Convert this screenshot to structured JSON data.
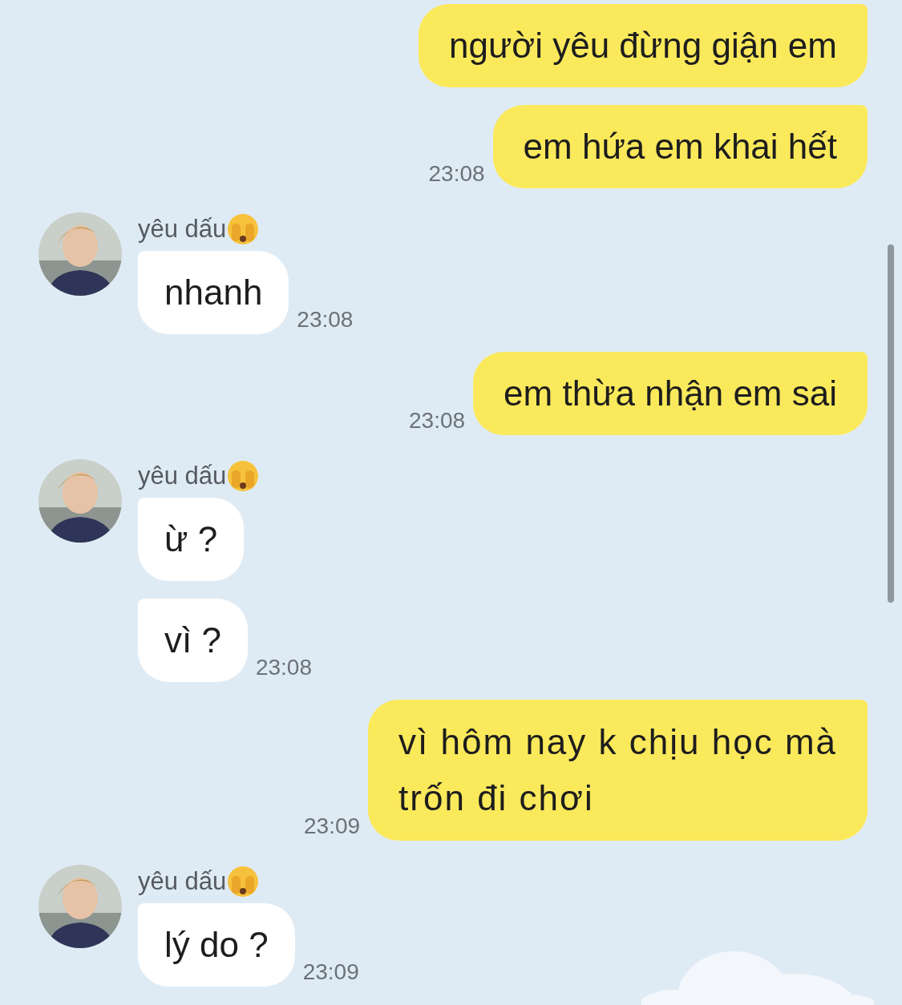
{
  "messages": [
    {
      "kind": "sent",
      "lines": [
        "người yêu đừng giận em"
      ]
    },
    {
      "kind": "sent",
      "lines": [
        "em hứa em khai hết"
      ],
      "time": "23:08"
    },
    {
      "kind": "received",
      "sender": "yêu dấu",
      "bubbles": [
        {
          "text": "nhanh"
        }
      ],
      "time": "23:08"
    },
    {
      "kind": "sent",
      "lines": [
        "em thừa nhận em sai"
      ],
      "time": "23:08"
    },
    {
      "kind": "received",
      "sender": "yêu dấu",
      "bubbles": [
        {
          "text": "ừ ?"
        },
        {
          "text": "vì ?"
        }
      ],
      "time": "23:08"
    },
    {
      "kind": "sent",
      "lines": [
        "vì hôm nay k chịu học mà",
        "trốn đi chơi"
      ],
      "time": "23:09"
    },
    {
      "kind": "received",
      "sender": "yêu dấu",
      "bubbles": [
        {
          "text": "lý do ?"
        }
      ],
      "time": "23:09"
    }
  ]
}
